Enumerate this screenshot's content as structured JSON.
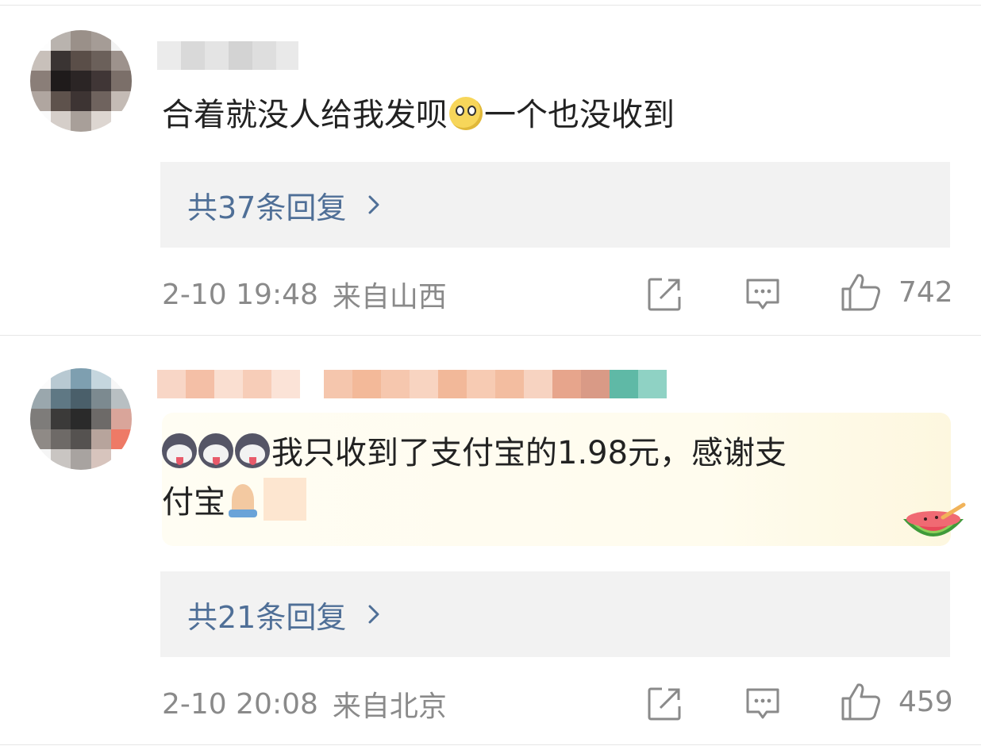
{
  "comments": [
    {
      "username": "",
      "text": "合着就没人给我发呗",
      "text_after_emoji": "一个也没收到",
      "replies_label": "共37条回复",
      "time": "2-10 19:48",
      "location": "来自山西",
      "likes": "742"
    },
    {
      "username": "",
      "text_line1": "我只收到了支付宝的1.98元，感谢支",
      "text_line2": "付宝",
      "replies_label": "共21条回复",
      "time": "2-10 20:08",
      "location": "来自北京",
      "likes": "459"
    }
  ],
  "icons": {
    "repost": "share-icon",
    "comment": "comment-icon",
    "like": "thumbs-up-icon",
    "chevron": "chevron-right-icon",
    "emoji1": "rolling-eyes-emoji",
    "emoji2": "husky-emoji",
    "emoji3": "praying-hands-emoji",
    "badge": "watermelon-badge"
  },
  "colors": {
    "link": "#4f6f97",
    "meta": "#8a8a8a",
    "text": "#222222",
    "reply_bg": "#f2f2f2"
  }
}
